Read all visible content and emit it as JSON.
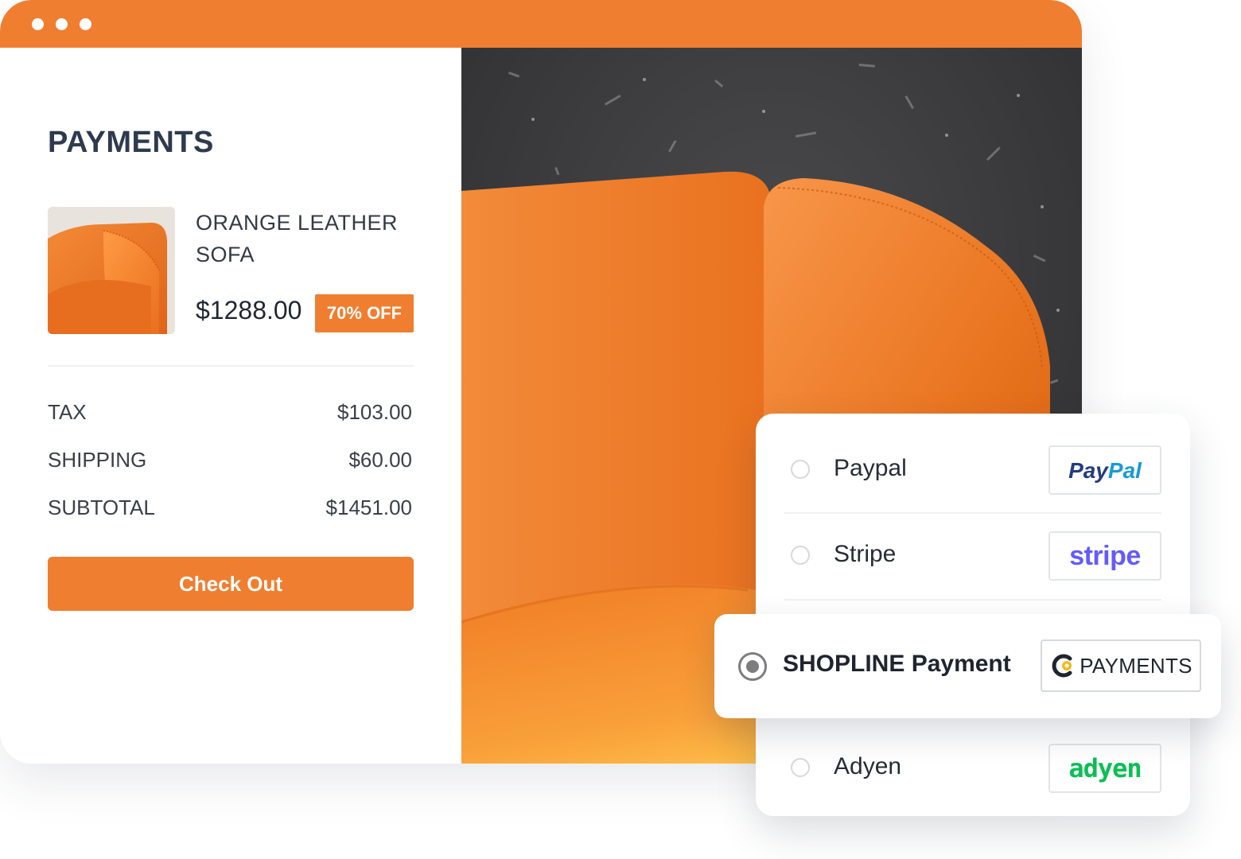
{
  "page": {
    "title": "PAYMENTS"
  },
  "product": {
    "name": "ORANGE LEATHER SOFA",
    "price": "$1288.00",
    "discount": "70% OFF"
  },
  "summary": [
    {
      "label": "TAX",
      "value": "$103.00"
    },
    {
      "label": "SHIPPING",
      "value": "$60.00"
    },
    {
      "label": "SUBTOTAL",
      "value": "$1451.00"
    }
  ],
  "checkout": {
    "label": "Check Out"
  },
  "payment_methods": [
    {
      "label": "Paypal",
      "logo_text": "PayPal",
      "selected": false
    },
    {
      "label": "Stripe",
      "logo_text": "stripe",
      "selected": false
    },
    {
      "label": "SHOPLINE Payment",
      "logo_text": "PAYMENTS",
      "selected": true
    },
    {
      "label": "Adyen",
      "logo_text": "adyen",
      "selected": false
    }
  ],
  "colors": {
    "accent": "#F07E30",
    "title": "#2E3A4E",
    "paypal_dark": "#253B80",
    "paypal_light": "#179BD7",
    "stripe": "#635BFF",
    "adyen": "#0ABF53",
    "shopline_gold": "#F5B81C"
  },
  "icons": [
    "window-dot",
    "radio-button",
    "paypal-logo",
    "stripe-logo",
    "shopline-logo",
    "adyen-logo"
  ]
}
